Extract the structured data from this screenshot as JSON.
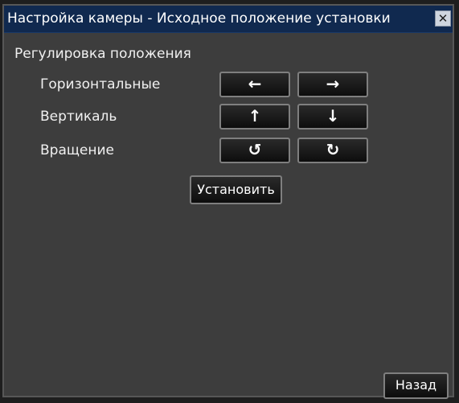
{
  "window": {
    "title": "Настройка камеры - Исходное положение установки",
    "close_icon": "✕"
  },
  "position_adjust": {
    "heading": "Регулировка положения",
    "rows": [
      {
        "label": "Горизонтальные",
        "left_icon": "←",
        "right_icon": "→",
        "left_name": "arrow-left-icon",
        "right_name": "arrow-right-icon"
      },
      {
        "label": "Вертикаль",
        "left_icon": "↑",
        "right_icon": "↓",
        "left_name": "arrow-up-icon",
        "right_name": "arrow-down-icon"
      },
      {
        "label": "Вращение",
        "left_icon": "↺",
        "right_icon": "↻",
        "left_name": "rotate-ccw-icon",
        "right_name": "rotate-cw-icon"
      }
    ]
  },
  "set_button": "Установить",
  "back_button": "Назад"
}
